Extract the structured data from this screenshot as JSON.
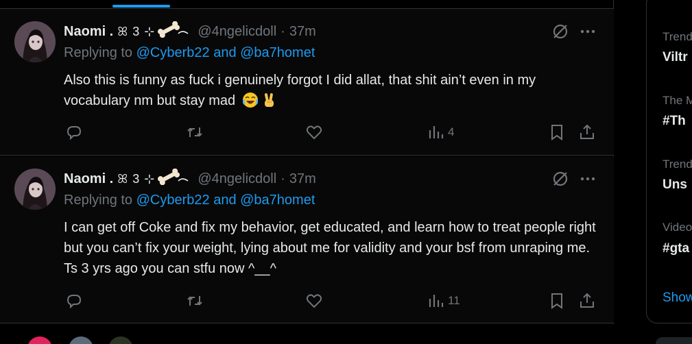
{
  "tweets": [
    {
      "display_name": "Naomi .",
      "decoration": "ꕤ 3 ⊹",
      "handle": "@4ngelicdoll",
      "separator": "·",
      "time": "37m",
      "replying_prefix": "Replying to ",
      "replying_to": "@Cyberb22 and @ba7homet",
      "text": "Also this is funny as fuck i genuinely forgot I did allat, that shit ain’t even in my vocabulary nm but stay mad",
      "views": "4"
    },
    {
      "display_name": "Naomi .",
      "decoration": "ꕤ 3 ⊹",
      "handle": "@4ngelicdoll",
      "separator": "·",
      "time": "37m",
      "replying_prefix": "Replying to ",
      "replying_to": "@Cyberb22 and @ba7homet",
      "text": "I can get off Coke and fix my behavior, get educated, and learn how to treat people right but you can’t fix your weight, lying about me for validity and your bsf from unraping me. Ts 3 yrs ago you can stfu now ^__^",
      "views": "11"
    }
  ],
  "sidebar": {
    "items": [
      {
        "meta": "Trend",
        "title": "Viltr"
      },
      {
        "meta": "The M",
        "title": "#Th"
      },
      {
        "meta": "Trend",
        "title": "Uns"
      },
      {
        "meta": "Video",
        "title": "#gta"
      }
    ],
    "show_more": "Show"
  },
  "colors": {
    "background": "#000000",
    "tweet_background": "#080808",
    "accent": "#1d9bf0",
    "text_primary": "#e7e9ea",
    "text_secondary": "#71767b",
    "border": "#2f3336"
  },
  "icons": [
    "reply-icon",
    "retweet-icon",
    "like-icon",
    "views-icon",
    "bookmark-icon",
    "share-icon",
    "grok-icon",
    "more-icon",
    "bone-emoji",
    "laughing-emoji",
    "victory-hand-emoji"
  ]
}
